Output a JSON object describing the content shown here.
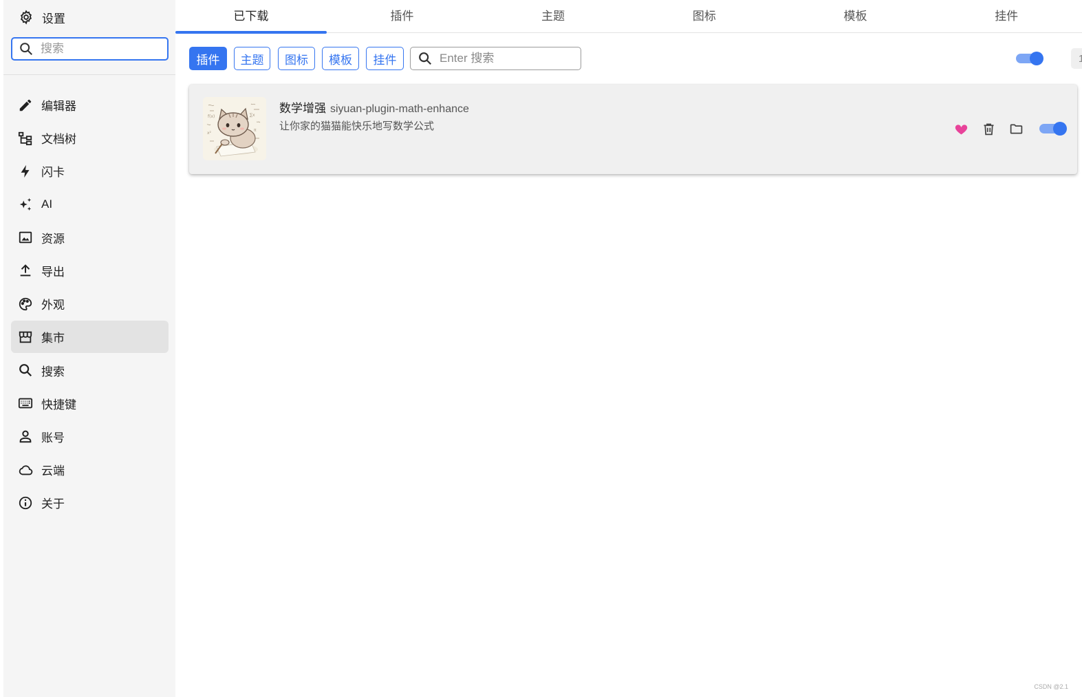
{
  "sidebar": {
    "header": {
      "icon": "gear-icon",
      "label": "设置"
    },
    "search": {
      "placeholder": "搜索",
      "value": ""
    },
    "items": [
      {
        "icon": "pencil-icon",
        "label": "编辑器"
      },
      {
        "icon": "file-tree-icon",
        "label": "文档树"
      },
      {
        "icon": "lightning-icon",
        "label": "闪卡"
      },
      {
        "icon": "sparkles-icon",
        "label": "AI"
      },
      {
        "icon": "image-icon",
        "label": "资源"
      },
      {
        "icon": "export-icon",
        "label": "导出"
      },
      {
        "icon": "palette-icon",
        "label": "外观"
      },
      {
        "icon": "store-icon",
        "label": "集市",
        "active": true
      },
      {
        "icon": "search-icon",
        "label": "搜索"
      },
      {
        "icon": "keyboard-icon",
        "label": "快捷键"
      },
      {
        "icon": "account-icon",
        "label": "账号"
      },
      {
        "icon": "cloud-icon",
        "label": "云端"
      },
      {
        "icon": "info-icon",
        "label": "关于"
      }
    ]
  },
  "tabs": [
    {
      "label": "已下载",
      "active": true
    },
    {
      "label": "插件"
    },
    {
      "label": "主题"
    },
    {
      "label": "图标"
    },
    {
      "label": "模板"
    },
    {
      "label": "挂件"
    }
  ],
  "filters": {
    "chips": [
      {
        "label": "插件",
        "active": true
      },
      {
        "label": "主题"
      },
      {
        "label": "图标"
      },
      {
        "label": "模板"
      },
      {
        "label": "挂件"
      }
    ],
    "search_placeholder": "Enter 搜索",
    "toggle_on": true,
    "count": "1"
  },
  "plugins": [
    {
      "name": "数学增强",
      "package": "siyuan-plugin-math-enhance",
      "description": "让你家的猫猫能快乐地写数学公式",
      "enabled": true,
      "actions": [
        "heart-icon",
        "trash-icon",
        "folder-icon"
      ]
    }
  ],
  "colors": {
    "accent": "#3575f0",
    "heart": "#e8439a",
    "sidebar_bg": "#f5f5f5",
    "card_bg": "#f0f0f0"
  },
  "watermark": "CSDN @2.1"
}
